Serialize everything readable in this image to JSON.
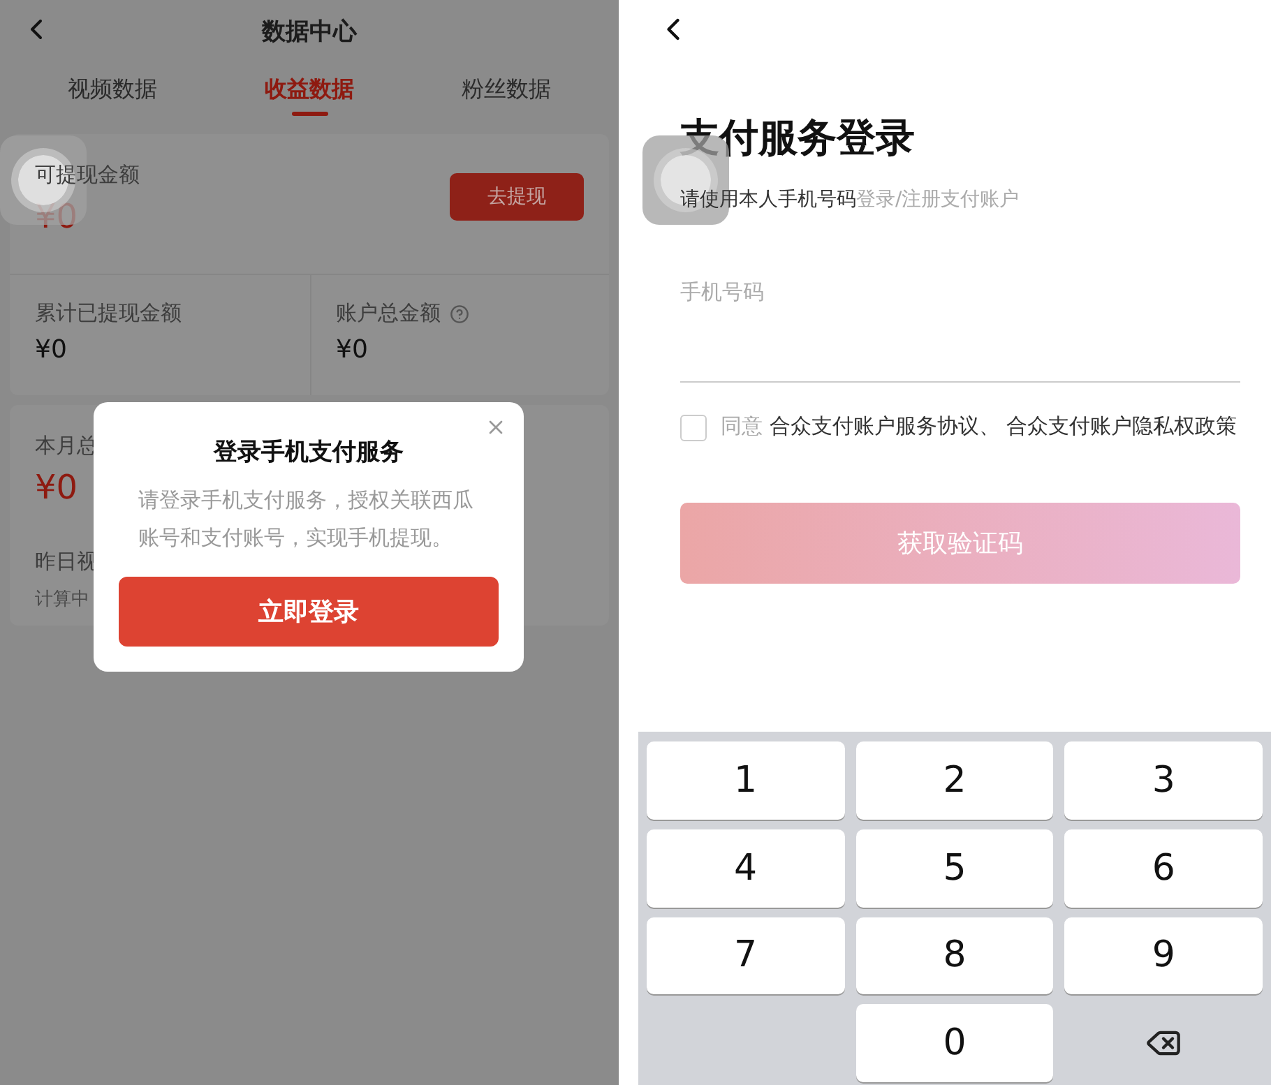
{
  "left_screen": {
    "title": "数据中心",
    "tabs": [
      {
        "label": "视频数据",
        "selected": false
      },
      {
        "label": "收益数据",
        "selected": true
      },
      {
        "label": "粉丝数据",
        "selected": false
      }
    ],
    "balance": {
      "label": "可提现金额",
      "amount": "¥0",
      "button": "去提现"
    },
    "stats": [
      {
        "label": "累计已提现金额",
        "amount": "¥0",
        "help": false
      },
      {
        "label": "账户总金额",
        "amount": "¥0",
        "help": true
      }
    ],
    "month": {
      "label": "本月总",
      "amount": "¥0"
    },
    "yesterday": {
      "label": "昨日视",
      "status": "计算中"
    },
    "dialog": {
      "title": "登录手机支付服务",
      "body": "请登录手机支付服务，授权关联西瓜账号和支付账号，实现手机提现。",
      "button": "立即登录"
    }
  },
  "right_screen": {
    "title": "支付服务登录",
    "subtitle": {
      "strong": "请使用本人手机号码",
      "rest": "登录/注册支付账户"
    },
    "phone": {
      "placeholder": "手机号码"
    },
    "agreement": {
      "checked": false,
      "prefix": "同意",
      "text": "合众支付账户服务协议、 合众支付账户隐私权政策"
    },
    "button": {
      "label": "获取验证码",
      "disabled": true
    },
    "keypad": [
      {
        "kind": "digit",
        "label": "1"
      },
      {
        "kind": "digit",
        "label": "2"
      },
      {
        "kind": "digit",
        "label": "3"
      },
      {
        "kind": "digit",
        "label": "4"
      },
      {
        "kind": "digit",
        "label": "5"
      },
      {
        "kind": "digit",
        "label": "6"
      },
      {
        "kind": "digit",
        "label": "7"
      },
      {
        "kind": "digit",
        "label": "8"
      },
      {
        "kind": "digit",
        "label": "9"
      },
      {
        "kind": "blank"
      },
      {
        "kind": "digit",
        "label": "0"
      },
      {
        "kind": "backspace"
      }
    ]
  }
}
